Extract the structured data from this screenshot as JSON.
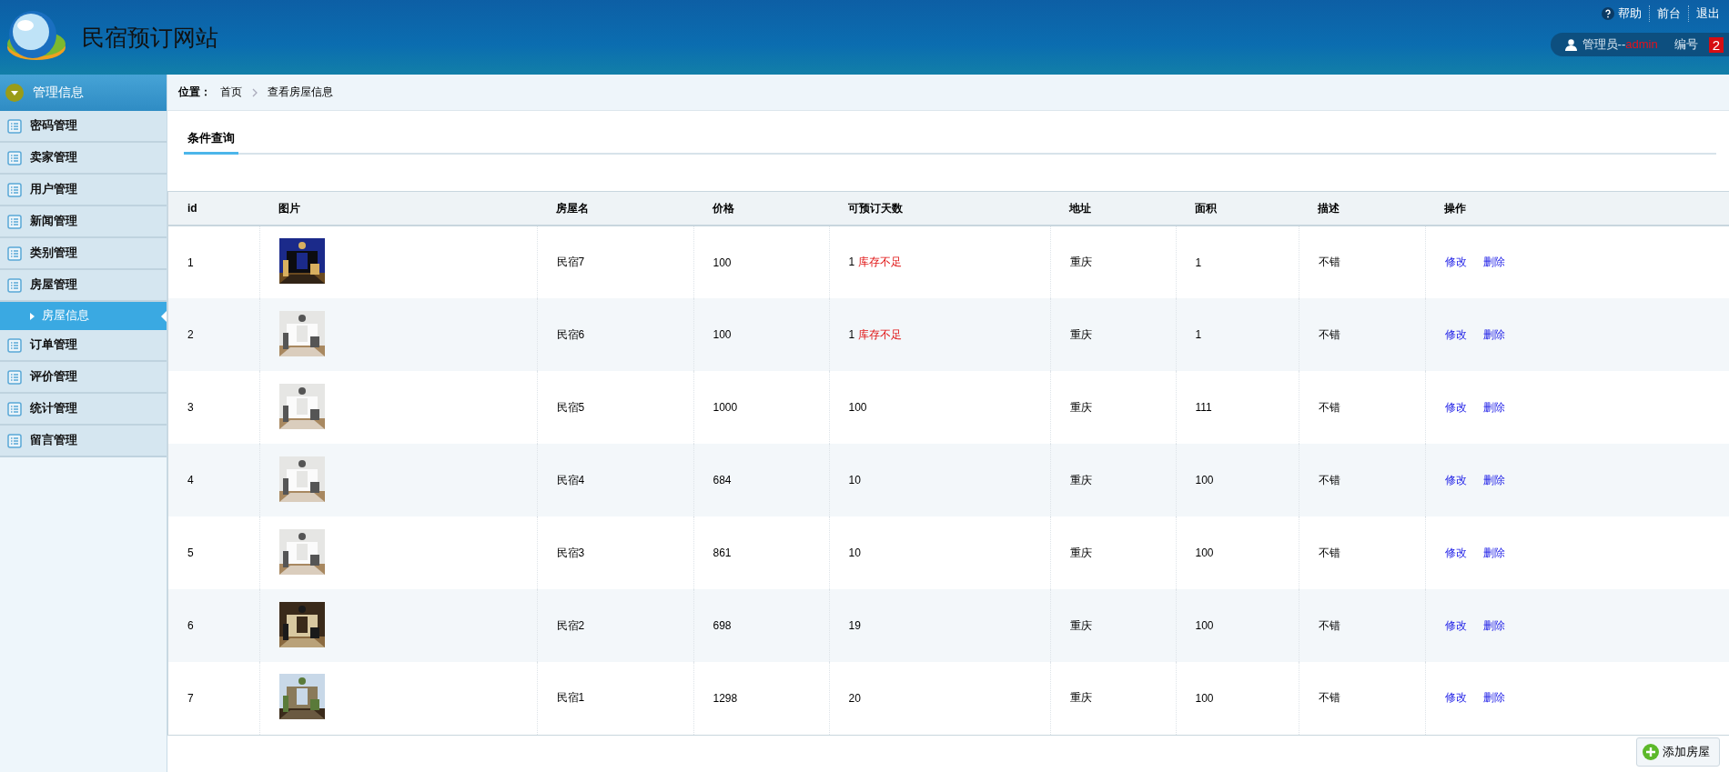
{
  "header": {
    "title": "民宿预订网站",
    "links": [
      "帮助",
      "前台",
      "退出"
    ],
    "user": {
      "role": "管理员--",
      "name": "admin",
      "number_label": "编号",
      "badge": "2"
    }
  },
  "sidebar": {
    "title": "管理信息",
    "items": [
      {
        "label": "密码管理",
        "selected": false
      },
      {
        "label": "卖家管理",
        "selected": false
      },
      {
        "label": "用户管理",
        "selected": false
      },
      {
        "label": "新闻管理",
        "selected": false
      },
      {
        "label": "类别管理",
        "selected": false
      },
      {
        "label": "房屋管理",
        "selected": false,
        "children": [
          {
            "label": "房屋信息",
            "selected": true
          }
        ]
      },
      {
        "label": "订单管理",
        "selected": false
      },
      {
        "label": "评价管理",
        "selected": false
      },
      {
        "label": "统计管理",
        "selected": false
      },
      {
        "label": "留言管理",
        "selected": false
      }
    ]
  },
  "breadcrumb": {
    "label": "位置：",
    "items": [
      "首页",
      "查看房屋信息"
    ]
  },
  "tabs": [
    {
      "label": "条件查询",
      "selected": true
    }
  ],
  "table": {
    "columns": [
      "id",
      "图片",
      "房屋名",
      "价格",
      "可预订天数",
      "地址",
      "面积",
      "描述",
      "操作"
    ],
    "rows": [
      {
        "id": "1",
        "photo": {
          "kind": "picture"
        },
        "name": "民宿7",
        "price": "100",
        "days": "1",
        "warning": "库存不足",
        "address": "重庆",
        "area": "1",
        "description": "不错",
        "actions": [
          "修改",
          "删除"
        ]
      },
      {
        "id": "2",
        "photo": {
          "kind": "picture"
        },
        "name": "民宿6",
        "price": "100",
        "days": "1",
        "warning": "库存不足",
        "address": "重庆",
        "area": "1",
        "description": "不错",
        "actions": [
          "修改",
          "删除"
        ]
      },
      {
        "id": "3",
        "photo": {
          "kind": "picture"
        },
        "name": "民宿5",
        "price": "1000",
        "days": "100",
        "address": "重庆",
        "area": "111",
        "description": "不错",
        "actions": [
          "修改",
          "删除"
        ]
      },
      {
        "id": "4",
        "photo": {
          "kind": "picture"
        },
        "name": "民宿4",
        "price": "684",
        "days": "10",
        "address": "重庆",
        "area": "100",
        "description": "不错",
        "actions": [
          "修改",
          "删除"
        ]
      },
      {
        "id": "5",
        "photo": {
          "kind": "picture"
        },
        "name": "民宿3",
        "price": "861",
        "days": "10",
        "address": "重庆",
        "area": "100",
        "description": "不错",
        "actions": [
          "修改",
          "删除"
        ]
      },
      {
        "id": "6",
        "photo": {
          "kind": "picture"
        },
        "name": "民宿2",
        "price": "698",
        "days": "19",
        "address": "重庆",
        "area": "100",
        "description": "不错",
        "actions": [
          "修改",
          "删除"
        ]
      },
      {
        "id": "7",
        "photo": {
          "kind": "picture"
        },
        "name": "民宿1",
        "price": "1298",
        "days": "20",
        "address": "重庆",
        "area": "100",
        "description": "不错",
        "actions": [
          "修改",
          "删除"
        ]
      }
    ]
  },
  "add_button": "添加房屋"
}
